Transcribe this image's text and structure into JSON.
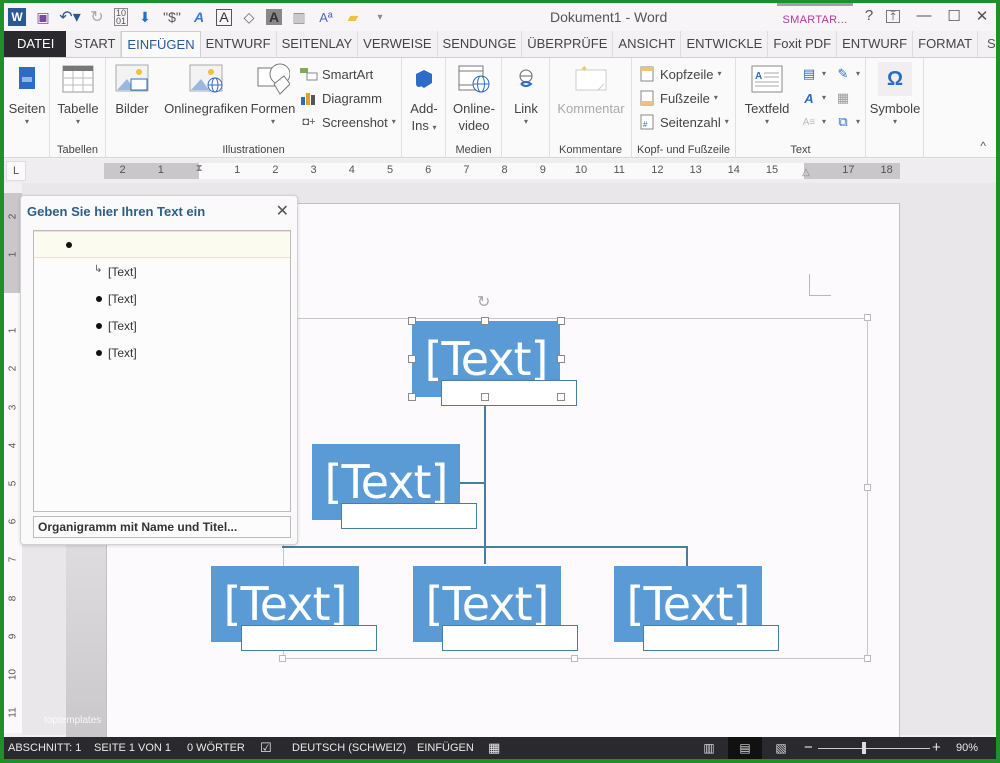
{
  "window": {
    "title": "Dokument1 - Word",
    "context_tab_group": "SMARTAR...",
    "help": "?",
    "restore_ribbon": "⊼",
    "minimize": "—",
    "maximize": "☐",
    "close": "✕"
  },
  "qat": [
    {
      "name": "word-logo-icon",
      "glyph": "W"
    },
    {
      "name": "save-icon",
      "glyph": "💾"
    },
    {
      "name": "undo-icon",
      "glyph": "↶"
    },
    {
      "name": "redo-icon",
      "glyph": "↻"
    },
    {
      "name": "binary-icon",
      "glyph": "⁰¹"
    },
    {
      "name": "download-icon",
      "glyph": "⬇"
    },
    {
      "name": "currency-icon",
      "glyph": "\"$\""
    },
    {
      "name": "text-effect-icon",
      "glyph": "A"
    },
    {
      "name": "text-box-icon",
      "glyph": "A"
    },
    {
      "name": "fill-color-icon",
      "glyph": "◇"
    },
    {
      "name": "highlight-a-icon",
      "glyph": "A"
    },
    {
      "name": "columns-icon",
      "glyph": "▥"
    },
    {
      "name": "font-size-icon",
      "glyph": "Aª"
    },
    {
      "name": "open-folder-icon",
      "glyph": "📂"
    },
    {
      "name": "customize-qat-icon",
      "glyph": "▾"
    }
  ],
  "tabs": [
    {
      "label": "DATEI",
      "type": "file"
    },
    {
      "label": "START"
    },
    {
      "label": "EINFÜGEN",
      "active": true
    },
    {
      "label": "ENTWURF"
    },
    {
      "label": "SEITENLAY"
    },
    {
      "label": "VERWEISE"
    },
    {
      "label": "SENDUNGE"
    },
    {
      "label": "ÜBERPRÜFE"
    },
    {
      "label": "ANSICHT"
    },
    {
      "label": "ENTWICKLE"
    },
    {
      "label": "Foxit PDF"
    },
    {
      "label": "ENTWURF"
    },
    {
      "label": "FORMAT"
    }
  ],
  "user": "Salvisber... ▾",
  "ribbon": {
    "groups": {
      "tabellen": "Tabellen",
      "illustrationen": "Illustrationen",
      "medien": "Medien",
      "kommentare": "Kommentare",
      "kopf_fuss": "Kopf- und Fußzeile",
      "text": "Text"
    },
    "buttons": {
      "seiten": "Seiten",
      "tabelle": "Tabelle",
      "bilder": "Bilder",
      "onlinegrafiken": "Onlinegrafiken",
      "formen": "Formen",
      "smartart": "SmartArt",
      "diagramm": "Diagramm",
      "screenshot": "Screenshot",
      "addins_1": "Add-",
      "addins_2": "Ins",
      "onlinevideo_1": "Online-",
      "onlinevideo_2": "video",
      "link": "Link",
      "kommentar": "Kommentar",
      "kopfzeile": "Kopfzeile",
      "fusszeile": "Fußzeile",
      "seitenzahl": "Seitenzahl",
      "textfeld": "Textfeld",
      "symbole": "Symbole",
      "caret": "▾",
      "collapse": "^"
    }
  },
  "ruler": {
    "tab_selector": "L",
    "h_ticks": [
      "2",
      "1",
      "1",
      "2",
      "3",
      "4",
      "5",
      "6",
      "7",
      "8",
      "9",
      "10",
      "11",
      "12",
      "13",
      "14",
      "15",
      "17",
      "18"
    ],
    "v_ticks": [
      "2",
      "1",
      "1",
      "2",
      "3",
      "4",
      "5",
      "6",
      "7",
      "8",
      "9",
      "10",
      "11"
    ]
  },
  "text_pane": {
    "title": "Geben Sie hier Ihren Text ein",
    "close": "✕",
    "items": [
      {
        "text": "",
        "level": 0
      },
      {
        "text": "[Text]",
        "level": 1,
        "assistant": true
      },
      {
        "text": "[Text]",
        "level": 1
      },
      {
        "text": "[Text]",
        "level": 1
      },
      {
        "text": "[Text]",
        "level": 1
      }
    ],
    "footer": "Organigramm mit Name und Titel..."
  },
  "smartart": {
    "fill_color": "#5b9bd5",
    "connector_color": "#4a7ea0",
    "nodes": [
      {
        "role": "top",
        "text": "[Text]"
      },
      {
        "role": "assistant",
        "text": "[Text]"
      },
      {
        "role": "child-1",
        "text": "[Text]"
      },
      {
        "role": "child-2",
        "text": "[Text]"
      },
      {
        "role": "child-3",
        "text": "[Text]"
      }
    ]
  },
  "watermark": "toptemplates",
  "statusbar": {
    "section": "ABSCHNITT: 1",
    "page": "SEITE 1 VON 1",
    "words": "0 WÖRTER",
    "language": "DEUTSCH (SCHWEIZ)",
    "mode": "EINFÜGEN",
    "zoom_minus": "−",
    "zoom_plus": "+",
    "zoom": "90%",
    "zoom_percent": 90
  }
}
